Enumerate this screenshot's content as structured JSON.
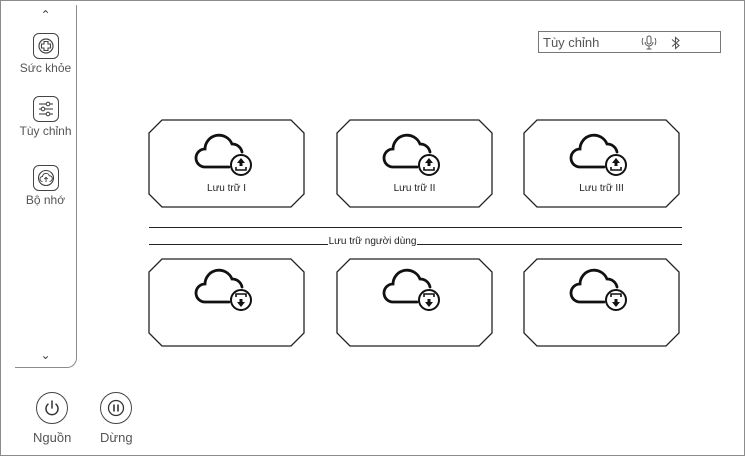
{
  "sidebar": {
    "scroll_up": "⌃",
    "scroll_down": "⌄",
    "items": [
      {
        "label": "Sức khỏe",
        "icon": "health-plus-icon"
      },
      {
        "label": "Tùy chỉnh",
        "icon": "sliders-icon"
      },
      {
        "label": "Bộ nhớ",
        "icon": "cloud-upload-icon"
      }
    ]
  },
  "bottom": {
    "power_label": "Nguồn",
    "pause_label": "Dừng"
  },
  "status": {
    "mode_label": "Tùy chỉnh",
    "icons": [
      "microphone-icon",
      "bluetooth-icon"
    ]
  },
  "storage": {
    "upload_cards": [
      {
        "label": "Lưu trữ I",
        "icon": "cloud-upload-icon"
      },
      {
        "label": "Lưu trữ II",
        "icon": "cloud-upload-icon"
      },
      {
        "label": "Lưu trữ III",
        "icon": "cloud-upload-icon"
      }
    ],
    "user_section_label": "Lưu trữ người dùng",
    "download_cards": [
      {
        "icon": "cloud-download-icon"
      },
      {
        "icon": "cloud-download-icon"
      },
      {
        "icon": "cloud-download-icon"
      }
    ]
  }
}
